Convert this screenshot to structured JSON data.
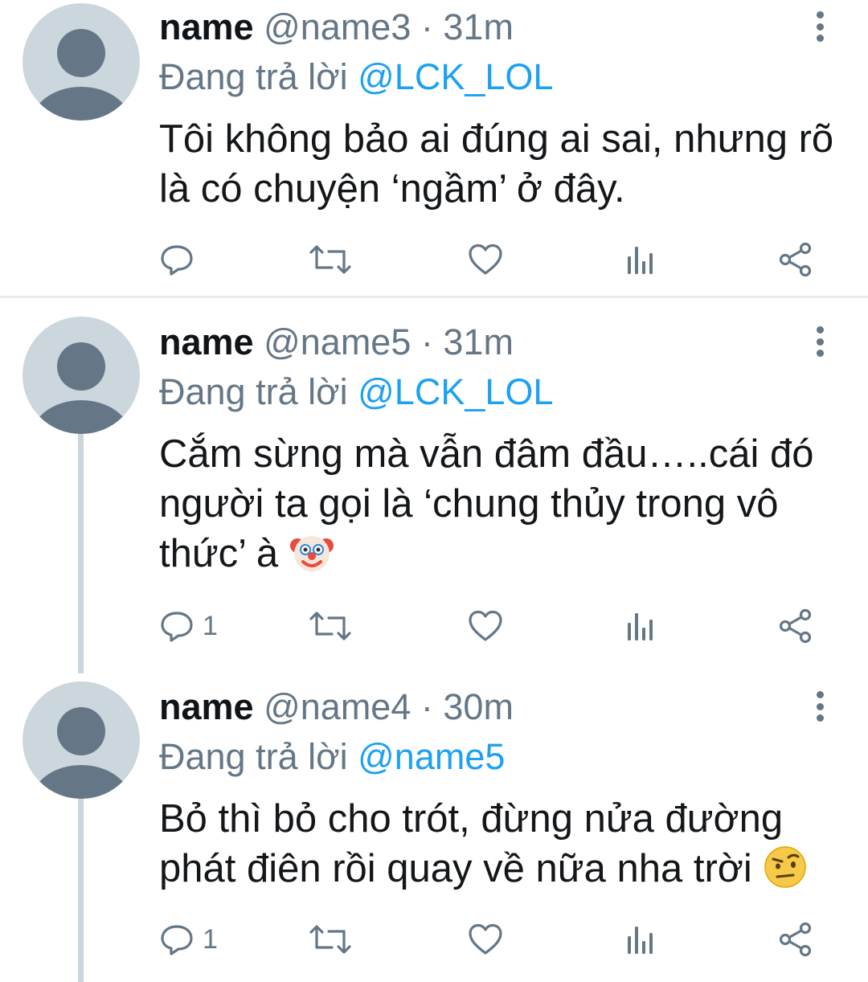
{
  "tweets": [
    {
      "display_name": "name",
      "handle": "@name3",
      "time": "31m",
      "reply_prefix": "Đang trả lời",
      "reply_to": "@LCK_LOL",
      "text": "Tôi không bảo ai đúng ai sai, nhưng rõ là có chuyện ‘ngầm’ ở đây.",
      "emoji": "",
      "reply_count": ""
    },
    {
      "display_name": "name",
      "handle": "@name5",
      "time": "31m",
      "reply_prefix": "Đang trả lời",
      "reply_to": "@LCK_LOL",
      "text": "Cắm sừng mà vẫn đâm đầu…..cái đó người ta gọi là ‘chung thủy trong vô thức’ à",
      "emoji": "clown-face",
      "reply_count": "1"
    },
    {
      "display_name": "name",
      "handle": "@name4",
      "time": "30m",
      "reply_prefix": "Đang trả lời",
      "reply_to": "@name5",
      "text": "Bỏ thì bỏ cho trót, đừng nửa đường phát điên rồi quay về nữa nha trời",
      "emoji": "face-with-raised-eyebrow",
      "reply_count": "1"
    }
  ],
  "icons": [
    "reply-icon",
    "retweet-icon",
    "like-icon",
    "analytics-icon",
    "share-icon",
    "more-options-icon"
  ],
  "colors": {
    "mention": "#1da1f2",
    "secondary_text": "#657786",
    "avatar_bg": "#ccd6dd",
    "avatar_figure": "#657786",
    "divider": "#e6ecf0"
  }
}
